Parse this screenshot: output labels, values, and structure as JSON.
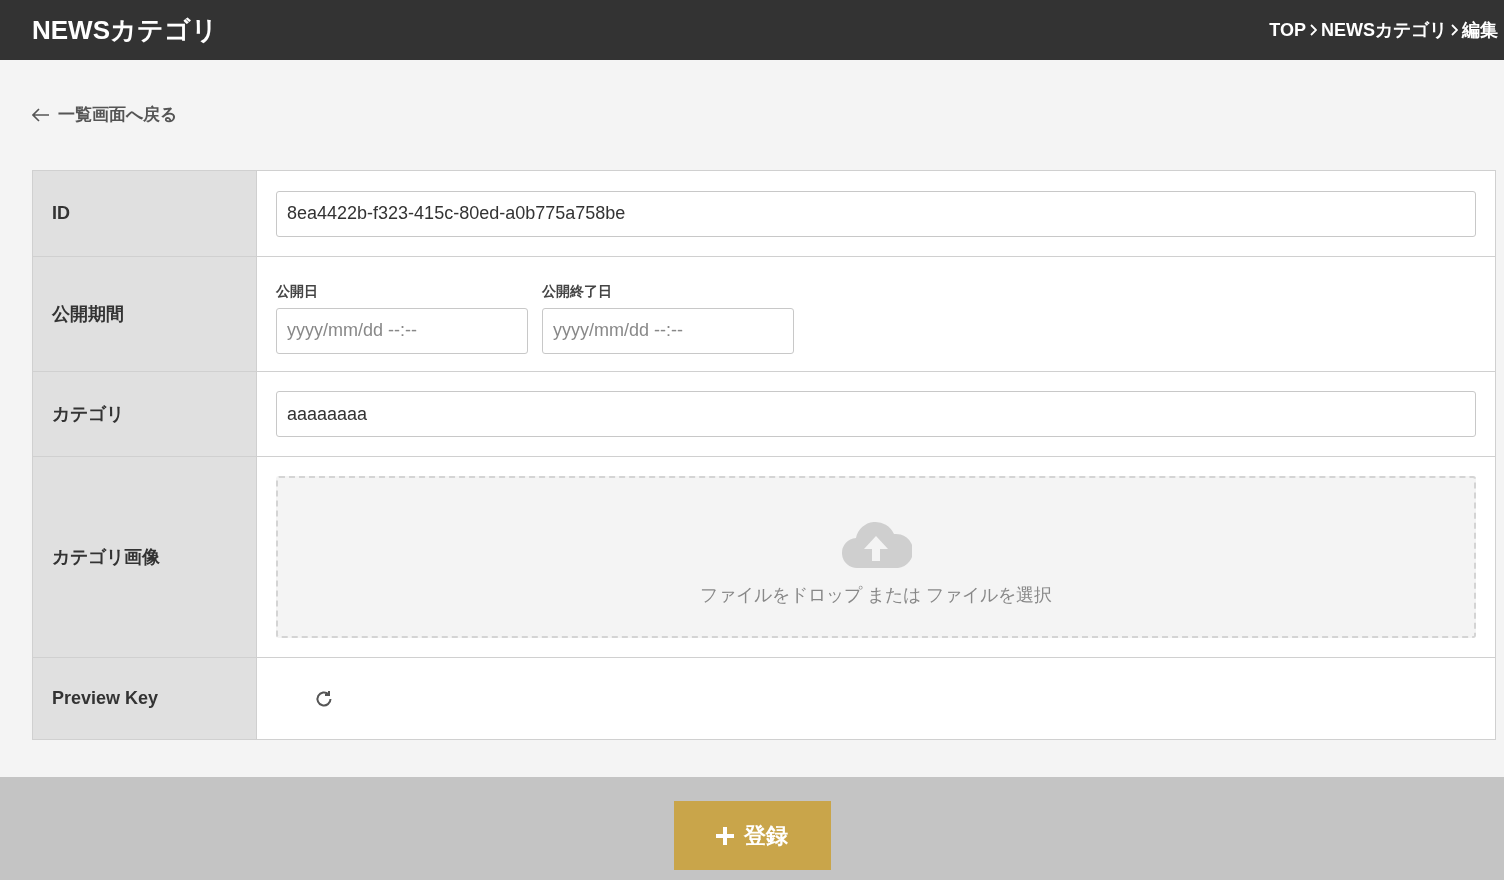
{
  "header": {
    "title": "NEWSカテゴリ",
    "breadcrumb": [
      {
        "label": "TOP"
      },
      {
        "label": "NEWSカテゴリ"
      },
      {
        "label": "編集"
      }
    ]
  },
  "back_link": "一覧画面へ戻る",
  "form": {
    "rows": [
      {
        "kind": "text",
        "label": "ID",
        "value": "8ea4422b-f323-415c-80ed-a0b775a758be"
      },
      {
        "kind": "date_range",
        "label": "公開期間",
        "fields": [
          {
            "label": "公開日",
            "placeholder": "yyyy/mm/dd --:--"
          },
          {
            "label": "公開終了日",
            "placeholder": "yyyy/mm/dd --:--"
          }
        ]
      },
      {
        "kind": "text",
        "label": "カテゴリ",
        "value": "aaaaaaaa"
      },
      {
        "kind": "upload",
        "label": "カテゴリ画像",
        "text": "ファイルをドロップ または ファイルを選択"
      },
      {
        "kind": "preview_key",
        "label": "Preview Key"
      }
    ]
  },
  "submit_button": "登録"
}
